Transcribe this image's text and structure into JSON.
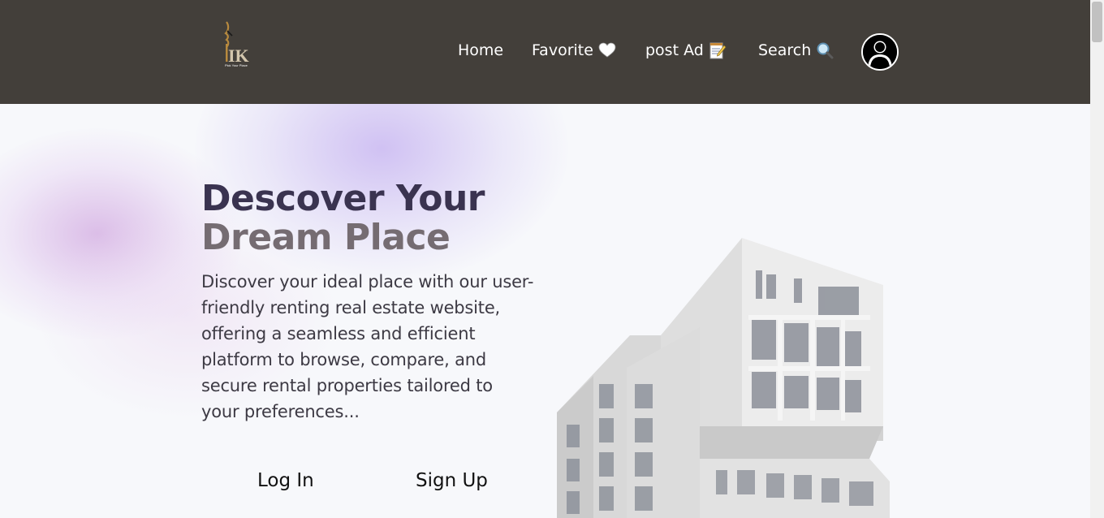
{
  "nav": {
    "logo_text": "IK",
    "logo_subtext": "Pick Your Place",
    "links": [
      {
        "label": "Home",
        "icon": ""
      },
      {
        "label": "Favorite",
        "icon": "heart-icon"
      },
      {
        "label": "post Ad",
        "icon": "memo-icon"
      },
      {
        "label": "Search",
        "icon": "search-icon"
      }
    ],
    "avatar_icon": "user-avatar-icon"
  },
  "hero": {
    "title_line1": "Descover Your",
    "title_line2": "Dream Place",
    "description": "Discover your ideal place with our user-friendly renting real estate website, offering a seamless and efficient platform to browse, compare, and secure rental properties tailored to your preferences...",
    "login_label": "Log In",
    "signup_label": "Sign Up"
  },
  "colors": {
    "navbar_bg": "#433f3a",
    "title_dark": "#3a3350",
    "title_muted": "#756c72",
    "page_bg": "#f7f8fb"
  }
}
